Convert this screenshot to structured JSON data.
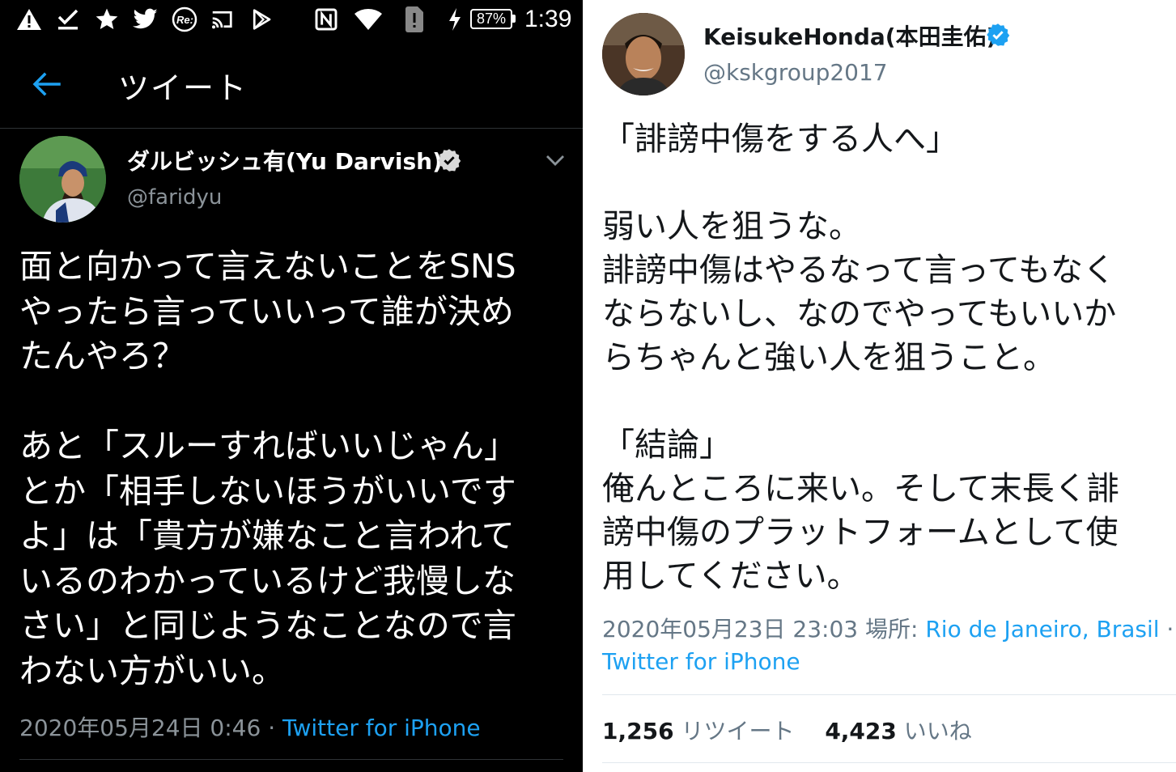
{
  "left_panel": {
    "status_bar": {
      "icons": [
        "warning-icon",
        "checkmark-download-icon",
        "star-icon",
        "twitter-bird-icon",
        "re-app-icon",
        "cast-icon",
        "play-store-icon",
        "nfc-icon",
        "wifi-icon",
        "sim-alert-icon",
        "charging-icon"
      ],
      "battery": "87%",
      "time": "1:39"
    },
    "header": {
      "title": "ツイート"
    },
    "tweet": {
      "author_name": "ダルビッシュ有(Yu Darvish)",
      "handle": "@faridyu",
      "body_lines": [
        "面と向かって言えないことをSNS",
        "やったら言っていいって誰が決め",
        "たんやろ？",
        "",
        "あと「スルーすればいいじゃん」",
        "とか「相手しないほうがいいです",
        "よ」は「貴方が嫌なこと言われて",
        "いるのわかっているけど我慢しな",
        "さい」と同じようなことなので言",
        "わない方がいい。"
      ],
      "timestamp": "2020年05月24日 0:46 · ",
      "source": "Twitter for iPhone"
    },
    "colors": {
      "background": "#000000",
      "accent": "#1da1f2",
      "secondary_text": "#8b9399"
    }
  },
  "right_panel": {
    "tweet": {
      "author_name": "KeisukeHonda(本田圭佑)",
      "handle": "@kskgroup2017",
      "body_lines": [
        "「誹謗中傷をする人へ」",
        "",
        "弱い人を狙うな。",
        "誹謗中傷はやるなって言ってもなく",
        "ならないし、なのでやってもいいか",
        "らちゃんと強い人を狙うこと。",
        "",
        "「結論」",
        "俺んところに来い。そして末長く誹",
        "謗中傷のプラットフォームとして使",
        "用してください。"
      ],
      "timestamp": "2020年05月23日 23:03 場所: ",
      "location": "Rio de Janeiro, Brasil",
      "separator": " ·",
      "source": "Twitter for iPhone",
      "retweet_count": "1,256",
      "retweet_label": "リツイート",
      "like_count": "4,423",
      "like_label": "いいね"
    },
    "colors": {
      "background": "#ffffff",
      "accent": "#1da1f2",
      "secondary_text": "#657786"
    }
  }
}
